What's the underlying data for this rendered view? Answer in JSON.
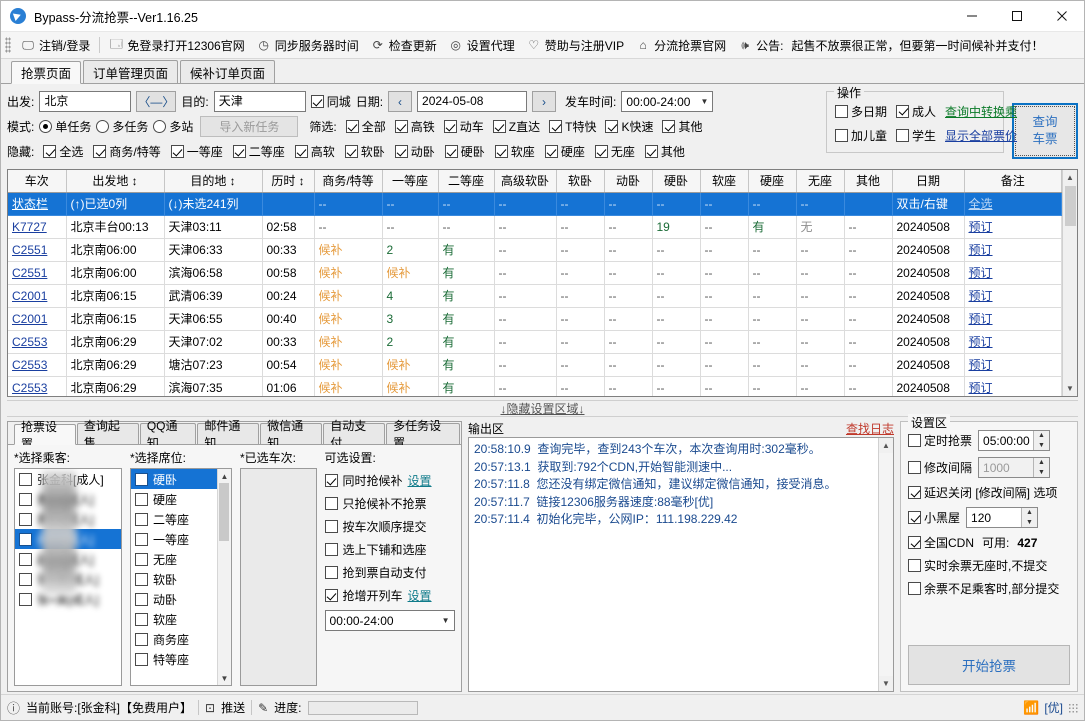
{
  "window": {
    "title": "Bypass-分流抢票--Ver1.16.25",
    "minimize": "—",
    "maximize": "☐",
    "close": "✕"
  },
  "toolbar": {
    "items": [
      {
        "icon": "monitor-icon",
        "glyph": "🖵",
        "label": "注销/登录"
      },
      {
        "icon": "window-icon",
        "glyph": "🗔",
        "label": "免登录打开12306官网"
      },
      {
        "icon": "clock-icon",
        "glyph": "◷",
        "label": "同步服务器时间"
      },
      {
        "icon": "refresh-icon",
        "glyph": "⟳",
        "label": "检查更新"
      },
      {
        "icon": "gear-icon",
        "glyph": "◎",
        "label": "设置代理"
      },
      {
        "icon": "heart-icon",
        "glyph": "♡",
        "label": "赞助与注册VIP"
      },
      {
        "icon": "home-icon",
        "glyph": "⌂",
        "label": "分流抢票官网"
      },
      {
        "icon": "speaker-icon",
        "glyph": "🕪",
        "label": "公告:"
      }
    ],
    "notice": "起售不放票很正常，但要第一时间候补并支付！"
  },
  "tabs": [
    {
      "label": "抢票页面",
      "active": true
    },
    {
      "label": "订单管理页面",
      "active": false
    },
    {
      "label": "候补订单页面",
      "active": false
    }
  ],
  "query": {
    "from_label": "出发:",
    "from_value": "北京",
    "swap_label": "〈—〉",
    "to_label": "目的:",
    "to_value": "天津",
    "same_city_label": "同城",
    "same_city_checked": true,
    "date_label": "日期:",
    "prev_label": "‹",
    "date_value": "2024-05-08",
    "next_label": "›",
    "depart_time_label": "发车时间:",
    "depart_time_value": "00:00-24:00",
    "mode_label": "模式:",
    "modes": [
      {
        "label": "单任务",
        "checked": true
      },
      {
        "label": "多任务",
        "checked": false
      },
      {
        "label": "多站",
        "checked": false
      }
    ],
    "import_task_label": "导入新任务",
    "filter_label": "筛选:",
    "filters": [
      {
        "label": "全部",
        "checked": true
      },
      {
        "label": "高铁",
        "checked": true
      },
      {
        "label": "动车",
        "checked": true
      },
      {
        "label": "Z直达",
        "checked": true
      },
      {
        "label": "T特快",
        "checked": true
      },
      {
        "label": "K快速",
        "checked": true
      },
      {
        "label": "其他",
        "checked": true
      }
    ],
    "hide_label": "隐藏:",
    "hides": [
      {
        "label": "全选",
        "checked": true
      },
      {
        "label": "商务/特等",
        "checked": true
      },
      {
        "label": "一等座",
        "checked": true
      },
      {
        "label": "二等座",
        "checked": true
      },
      {
        "label": "高软",
        "checked": true
      },
      {
        "label": "软卧",
        "checked": true
      },
      {
        "label": "动卧",
        "checked": true
      },
      {
        "label": "硬卧",
        "checked": true
      },
      {
        "label": "软座",
        "checked": true
      },
      {
        "label": "硬座",
        "checked": true
      },
      {
        "label": "无座",
        "checked": true
      },
      {
        "label": "其他",
        "checked": true
      }
    ]
  },
  "operation": {
    "title": "操作",
    "multi_date": {
      "label": "多日期",
      "checked": false
    },
    "adult": {
      "label": "成人",
      "checked": true
    },
    "transfer_link": "查询中转换乘",
    "child": {
      "label": "加儿童",
      "checked": false
    },
    "student": {
      "label": "学生",
      "checked": false
    },
    "show_price_link": "显示全部票价",
    "query_button": {
      "line1": "查询",
      "line2": "车票"
    }
  },
  "table": {
    "headers": [
      "车次",
      "出发地 ↕",
      "目的地 ↕",
      "历时 ↕",
      "商务/特等",
      "一等座",
      "二等座",
      "高级软卧",
      "软卧",
      "动卧",
      "硬卧",
      "软座",
      "硬座",
      "无座",
      "其他",
      "日期",
      "备注"
    ],
    "status_row": {
      "train": "状态栏",
      "from": "(↑)已选0列",
      "to": "(↓)未选241列",
      "duration": "",
      "cells": [
        "--",
        "--",
        "--",
        "--",
        "--",
        "--",
        "--",
        "--",
        "--",
        "--",
        ""
      ],
      "date": "双击/右键",
      "note": "全选"
    },
    "rows": [
      {
        "train": "K7727",
        "from": "北京丰台00:13",
        "to": "天津03:11",
        "duration": "02:58",
        "cells": [
          {
            "t": "--",
            "c": "muted"
          },
          {
            "t": "--",
            "c": "muted"
          },
          {
            "t": "--",
            "c": "muted"
          },
          {
            "t": "--",
            "c": "muted"
          },
          {
            "t": "--",
            "c": "muted"
          },
          {
            "t": "--",
            "c": "muted"
          },
          {
            "t": "19",
            "c": "green"
          },
          {
            "t": "--",
            "c": "muted"
          },
          {
            "t": "有",
            "c": "green"
          },
          {
            "t": "无",
            "c": "grey"
          },
          {
            "t": "--",
            "c": "muted"
          }
        ],
        "date": "20240508",
        "note": "预订"
      },
      {
        "train": "C2551",
        "from": "北京南06:00",
        "to": "天津06:33",
        "duration": "00:33",
        "cells": [
          {
            "t": "候补",
            "c": "orange"
          },
          {
            "t": "2",
            "c": "green"
          },
          {
            "t": "有",
            "c": "green"
          },
          {
            "t": "--",
            "c": "muted"
          },
          {
            "t": "--",
            "c": "muted"
          },
          {
            "t": "--",
            "c": "muted"
          },
          {
            "t": "--",
            "c": "muted"
          },
          {
            "t": "--",
            "c": "muted"
          },
          {
            "t": "--",
            "c": "muted"
          },
          {
            "t": "--",
            "c": "muted"
          },
          {
            "t": "--",
            "c": "muted"
          }
        ],
        "date": "20240508",
        "note": "预订"
      },
      {
        "train": "C2551",
        "from": "北京南06:00",
        "to": "滨海06:58",
        "duration": "00:58",
        "cells": [
          {
            "t": "候补",
            "c": "orange"
          },
          {
            "t": "候补",
            "c": "orange"
          },
          {
            "t": "有",
            "c": "green"
          },
          {
            "t": "--",
            "c": "muted"
          },
          {
            "t": "--",
            "c": "muted"
          },
          {
            "t": "--",
            "c": "muted"
          },
          {
            "t": "--",
            "c": "muted"
          },
          {
            "t": "--",
            "c": "muted"
          },
          {
            "t": "--",
            "c": "muted"
          },
          {
            "t": "--",
            "c": "muted"
          },
          {
            "t": "--",
            "c": "muted"
          }
        ],
        "date": "20240508",
        "note": "预订"
      },
      {
        "train": "C2001",
        "from": "北京南06:15",
        "to": "武清06:39",
        "duration": "00:24",
        "cells": [
          {
            "t": "候补",
            "c": "orange"
          },
          {
            "t": "4",
            "c": "green"
          },
          {
            "t": "有",
            "c": "green"
          },
          {
            "t": "--",
            "c": "muted"
          },
          {
            "t": "--",
            "c": "muted"
          },
          {
            "t": "--",
            "c": "muted"
          },
          {
            "t": "--",
            "c": "muted"
          },
          {
            "t": "--",
            "c": "muted"
          },
          {
            "t": "--",
            "c": "muted"
          },
          {
            "t": "--",
            "c": "muted"
          },
          {
            "t": "--",
            "c": "muted"
          }
        ],
        "date": "20240508",
        "note": "预订"
      },
      {
        "train": "C2001",
        "from": "北京南06:15",
        "to": "天津06:55",
        "duration": "00:40",
        "cells": [
          {
            "t": "候补",
            "c": "orange"
          },
          {
            "t": "3",
            "c": "green"
          },
          {
            "t": "有",
            "c": "green"
          },
          {
            "t": "--",
            "c": "muted"
          },
          {
            "t": "--",
            "c": "muted"
          },
          {
            "t": "--",
            "c": "muted"
          },
          {
            "t": "--",
            "c": "muted"
          },
          {
            "t": "--",
            "c": "muted"
          },
          {
            "t": "--",
            "c": "muted"
          },
          {
            "t": "--",
            "c": "muted"
          },
          {
            "t": "--",
            "c": "muted"
          }
        ],
        "date": "20240508",
        "note": "预订"
      },
      {
        "train": "C2553",
        "from": "北京南06:29",
        "to": "天津07:02",
        "duration": "00:33",
        "cells": [
          {
            "t": "候补",
            "c": "orange"
          },
          {
            "t": "2",
            "c": "green"
          },
          {
            "t": "有",
            "c": "green"
          },
          {
            "t": "--",
            "c": "muted"
          },
          {
            "t": "--",
            "c": "muted"
          },
          {
            "t": "--",
            "c": "muted"
          },
          {
            "t": "--",
            "c": "muted"
          },
          {
            "t": "--",
            "c": "muted"
          },
          {
            "t": "--",
            "c": "muted"
          },
          {
            "t": "--",
            "c": "muted"
          },
          {
            "t": "--",
            "c": "muted"
          }
        ],
        "date": "20240508",
        "note": "预订"
      },
      {
        "train": "C2553",
        "from": "北京南06:29",
        "to": "塘沽07:23",
        "duration": "00:54",
        "cells": [
          {
            "t": "候补",
            "c": "orange"
          },
          {
            "t": "候补",
            "c": "orange"
          },
          {
            "t": "有",
            "c": "green"
          },
          {
            "t": "--",
            "c": "muted"
          },
          {
            "t": "--",
            "c": "muted"
          },
          {
            "t": "--",
            "c": "muted"
          },
          {
            "t": "--",
            "c": "muted"
          },
          {
            "t": "--",
            "c": "muted"
          },
          {
            "t": "--",
            "c": "muted"
          },
          {
            "t": "--",
            "c": "muted"
          },
          {
            "t": "--",
            "c": "muted"
          }
        ],
        "date": "20240508",
        "note": "预订"
      },
      {
        "train": "C2553",
        "from": "北京南06:29",
        "to": "滨海07:35",
        "duration": "01:06",
        "cells": [
          {
            "t": "候补",
            "c": "orange"
          },
          {
            "t": "候补",
            "c": "orange"
          },
          {
            "t": "有",
            "c": "green"
          },
          {
            "t": "--",
            "c": "muted"
          },
          {
            "t": "--",
            "c": "muted"
          },
          {
            "t": "--",
            "c": "muted"
          },
          {
            "t": "--",
            "c": "muted"
          },
          {
            "t": "--",
            "c": "muted"
          },
          {
            "t": "--",
            "c": "muted"
          },
          {
            "t": "--",
            "c": "muted"
          },
          {
            "t": "--",
            "c": "muted"
          }
        ],
        "date": "20240508",
        "note": "预订"
      }
    ]
  },
  "hide_settings_bar": "↓隐藏设置区域↓",
  "settings_tabs": [
    {
      "label": "抢票设置",
      "active": true
    },
    {
      "label": "查询起售",
      "active": false
    },
    {
      "label": "QQ通知",
      "active": false
    },
    {
      "label": "邮件通知",
      "active": false
    },
    {
      "label": "微信通知",
      "active": false
    },
    {
      "label": "自动支付",
      "active": false
    },
    {
      "label": "多任务设置",
      "active": false
    }
  ],
  "ticket_settings": {
    "passenger_head": "*选择乘客:",
    "passengers": [
      {
        "name": "张金科[成人]",
        "checked": false,
        "selected": false
      },
      {
        "name": "黄××[成人]",
        "checked": false,
        "selected": false
      },
      {
        "name": "黄××[成人]",
        "checked": false,
        "selected": false
      },
      {
        "name": "向××[成人]",
        "checked": false,
        "selected": true
      },
      {
        "name": "赵××[成人]",
        "checked": false,
        "selected": false
      },
      {
        "name": "张×香[成人]",
        "checked": false,
        "selected": false
      },
      {
        "name": "张×英[成人]",
        "checked": false,
        "selected": false
      }
    ],
    "seat_head": "*选择席位:",
    "seats": [
      {
        "label": "硬卧",
        "checked": false,
        "selected": true
      },
      {
        "label": "硬座",
        "checked": false,
        "selected": false
      },
      {
        "label": "二等座",
        "checked": false,
        "selected": false
      },
      {
        "label": "一等座",
        "checked": false,
        "selected": false
      },
      {
        "label": "无座",
        "checked": false,
        "selected": false
      },
      {
        "label": "软卧",
        "checked": false,
        "selected": false
      },
      {
        "label": "动卧",
        "checked": false,
        "selected": false
      },
      {
        "label": "软座",
        "checked": false,
        "selected": false
      },
      {
        "label": "商务座",
        "checked": false,
        "selected": false
      },
      {
        "label": "特等座",
        "checked": false,
        "selected": false
      }
    ],
    "chosen_train_head": "*已选车次:",
    "chosen_trains": [],
    "options_head": "可选设置:",
    "options": [
      {
        "label": "同时抢候补",
        "checked": true,
        "link": "设置"
      },
      {
        "label": "只抢候补不抢票",
        "checked": false,
        "link": ""
      },
      {
        "label": "按车次顺序提交",
        "checked": false,
        "link": ""
      },
      {
        "label": "选上下铺和选座",
        "checked": false,
        "link": ""
      },
      {
        "label": "抢到票自动支付",
        "checked": false,
        "link": ""
      },
      {
        "label": "抢增开列车",
        "checked": true,
        "link": "设置"
      }
    ],
    "time_range": "00:00-24:00"
  },
  "output": {
    "title": "输出区",
    "find_log_link": "查找日志",
    "lines": [
      {
        "time": "20:58:10.9",
        "text": "查询完毕，查到243个车次，本次查询用时:302毫秒。"
      },
      {
        "time": "20:57:13.1",
        "text": "获取到:792个CDN,开始智能测速中..."
      },
      {
        "time": "20:57:11.8",
        "text": "您还没有绑定微信通知，建议绑定微信通知，接受消息。"
      },
      {
        "time": "20:57:11.7",
        "text": "链接12306服务器速度:88毫秒[优]"
      },
      {
        "time": "20:57:11.4",
        "text": "初始化完毕，公网IP：111.198.229.42"
      }
    ]
  },
  "settings_zone": {
    "title": "设置区",
    "timed_grab": {
      "label": "定时抢票",
      "checked": false,
      "value": "05:00:00"
    },
    "interval": {
      "label": "修改间隔",
      "checked": false,
      "value": "1000",
      "disabled": true
    },
    "delay_close": {
      "label": "延迟关闭 [修改间隔] 选项",
      "checked": true
    },
    "blackroom": {
      "label": "小黑屋",
      "checked": true,
      "value": "120"
    },
    "cdn": {
      "label": "全国CDN",
      "checked": true,
      "available_label": "可用:",
      "available_value": "427"
    },
    "no_seat_no_submit": {
      "label": "实时余票无座时,不提交",
      "checked": false
    },
    "partial_submit": {
      "label": "余票不足乘客时,部分提交",
      "checked": false
    },
    "start_button": "开始抢票"
  },
  "statusbar": {
    "info_icon": "info-icon",
    "account_text": "当前账号:[张金科]【免费用户】",
    "push_label": "推送",
    "progress_label": "进度:",
    "network_quality": "[优]"
  },
  "colors": {
    "accent": "#1573d4",
    "link": "#1a3fa0",
    "green": "#1a6b36",
    "orange": "#e59a3c",
    "red": "#c0392b"
  }
}
